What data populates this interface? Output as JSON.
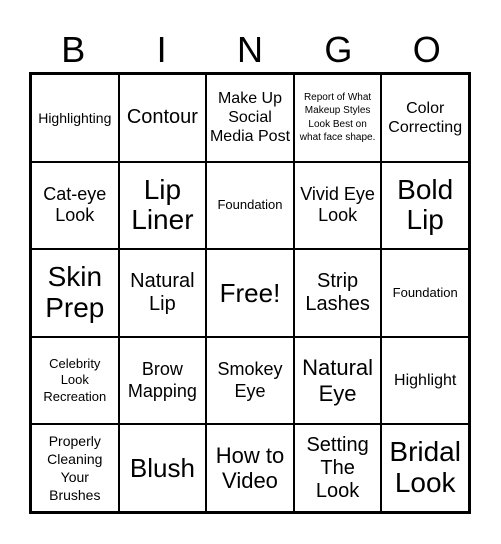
{
  "header": {
    "letters": [
      "B",
      "I",
      "N",
      "G",
      "O"
    ]
  },
  "cells": [
    [
      "Highlighting",
      "Contour",
      "Make Up Social Media Post",
      "Report of What Makeup Styles Look Best on what face shape.",
      "Color Correcting"
    ],
    [
      "Cat-eye Look",
      "Lip Liner",
      "Foundation",
      "Vivid Eye Look",
      "Bold Lip"
    ],
    [
      "Skin Prep",
      "Natural Lip",
      "Free!",
      "Strip Lashes",
      "Foundation"
    ],
    [
      "Celebrity Look Recreation",
      "Brow Mapping",
      "Smokey Eye",
      "Natural Eye",
      "Highlight"
    ],
    [
      "Properly Cleaning Your Brushes",
      "Blush",
      "How to Video",
      "Setting The Look",
      "Bridal Look"
    ]
  ]
}
